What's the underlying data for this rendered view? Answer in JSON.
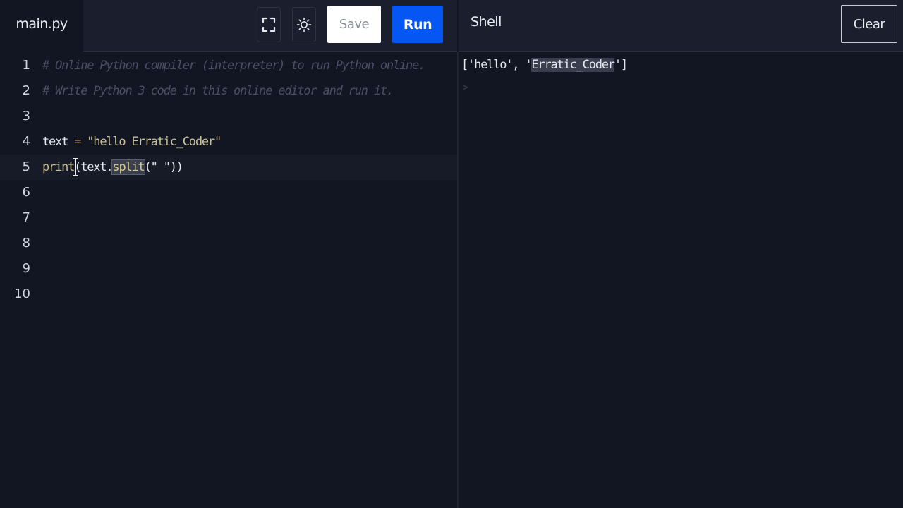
{
  "file_tab": {
    "label": "main.py"
  },
  "toolbar": {
    "fullscreen_icon": "fullscreen-icon",
    "theme_icon": "sun-icon",
    "save_label": "Save",
    "run_label": "Run",
    "run_color": "#0556f3"
  },
  "shell": {
    "title": "Shell",
    "clear_label": "Clear",
    "output_prefix": "['hello', '",
    "output_highlight": "Erratic_Coder",
    "output_suffix": "']",
    "prompt": ">"
  },
  "editor": {
    "lines": [
      {
        "num": "1",
        "text": "# Online Python compiler (interpreter) to run Python online."
      },
      {
        "num": "2",
        "text": "# Write Python 3 code in this online editor and run it."
      },
      {
        "num": "3",
        "text": ""
      },
      {
        "num": "4",
        "ident": "text",
        "op": " = ",
        "str": "\"hello Erratic_Coder\""
      },
      {
        "num": "5",
        "fn": "print",
        "open": "(text.",
        "sel": "split",
        "args": "(\" \"))"
      },
      {
        "num": "6",
        "text": ""
      },
      {
        "num": "7",
        "text": ""
      },
      {
        "num": "8",
        "text": ""
      },
      {
        "num": "9",
        "text": ""
      },
      {
        "num": "10",
        "text": ""
      }
    ]
  }
}
